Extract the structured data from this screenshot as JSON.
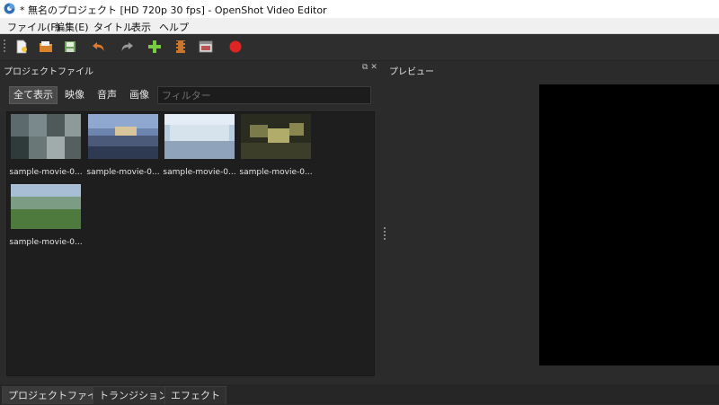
{
  "window": {
    "title": "* 無名のプロジェクト [HD 720p 30 fps] - OpenShot Video Editor",
    "app_icon": "openshot-logo-icon"
  },
  "menu": {
    "items": [
      "ファイル(F)",
      "編集(E)",
      "タイトル",
      "表示",
      "ヘルプ"
    ]
  },
  "toolbar": {
    "buttons": [
      {
        "name": "new-project",
        "icon": "new-file-icon"
      },
      {
        "name": "open-project",
        "icon": "open-folder-icon"
      },
      {
        "name": "save-project",
        "icon": "save-icon"
      },
      {
        "name": "undo",
        "icon": "undo-arrow-icon"
      },
      {
        "name": "redo",
        "icon": "redo-arrow-icon"
      },
      {
        "name": "import-files",
        "icon": "plus-icon"
      },
      {
        "name": "profile",
        "icon": "film-icon"
      },
      {
        "name": "fullscreen",
        "icon": "window-icon"
      },
      {
        "name": "export",
        "icon": "record-icon"
      }
    ]
  },
  "project_files": {
    "title": "プロジェクトファイル",
    "filters": [
      "全て表示",
      "映像",
      "音声",
      "画像"
    ],
    "filter_placeholder": "フィルター",
    "files": [
      {
        "label": "sample-movie-0..."
      },
      {
        "label": "sample-movie-0..."
      },
      {
        "label": "sample-movie-0..."
      },
      {
        "label": "sample-movie-0..."
      },
      {
        "label": "sample-movie-0..."
      }
    ]
  },
  "preview": {
    "title": "プレビュー"
  },
  "bottom_tabs": [
    "プロジェクトファイル",
    "トランジション",
    "エフェクト"
  ],
  "colors": {
    "background": "#2b2b2b",
    "panel_dark": "#1e1e1e",
    "preview": "#000000",
    "record": "#e02424",
    "add": "#7ac943",
    "undo": "#e07a2a"
  }
}
